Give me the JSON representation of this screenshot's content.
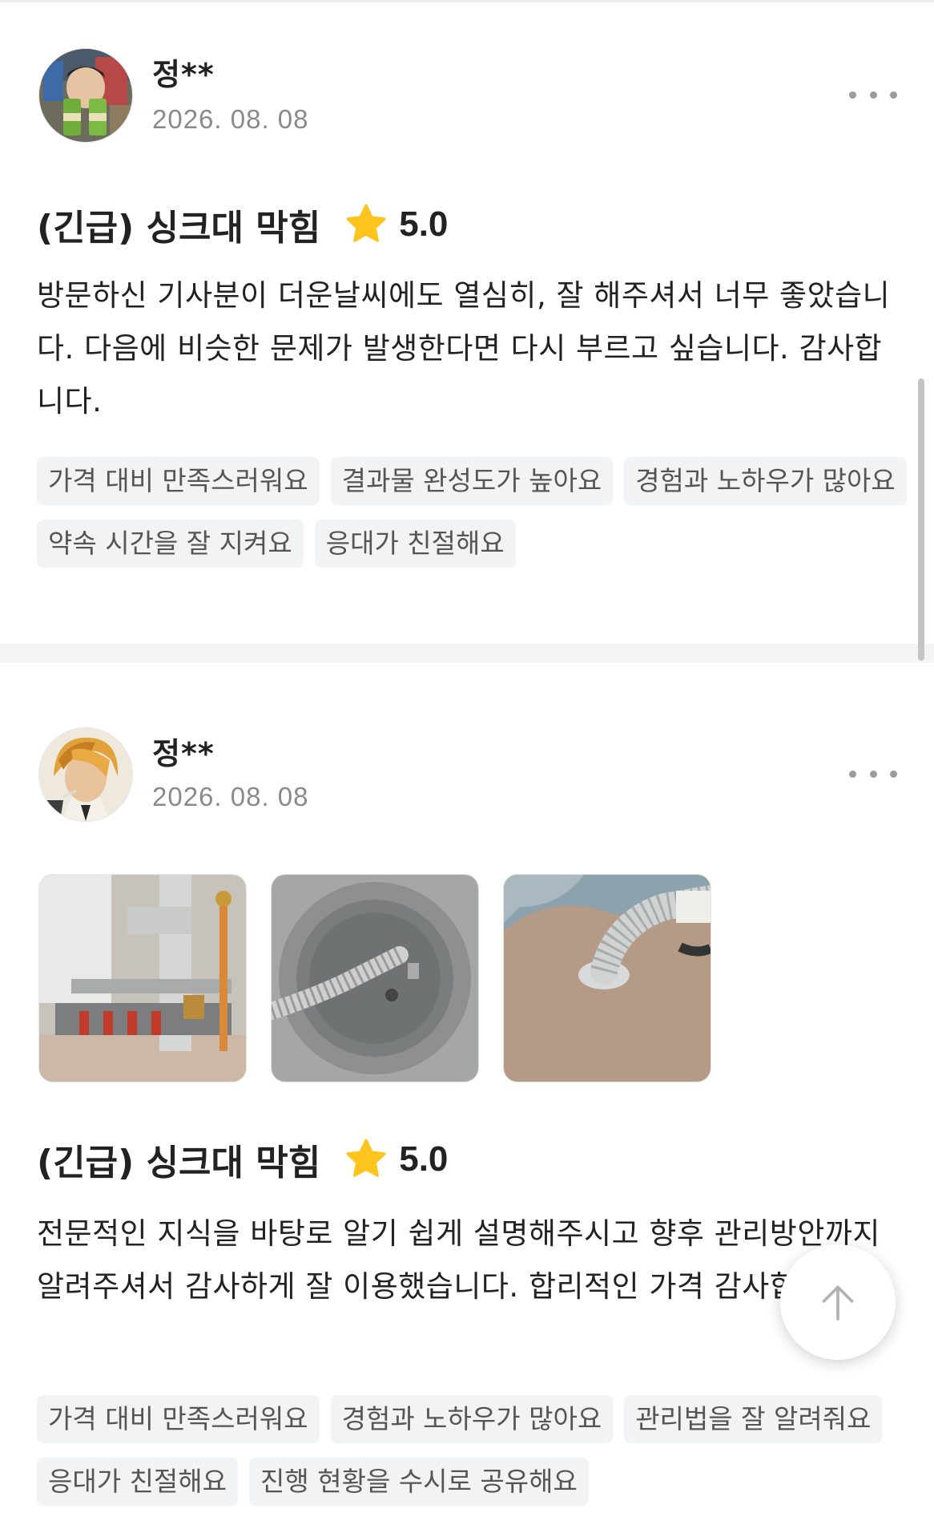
{
  "reviews": [
    {
      "user_name": "정**",
      "date": "2026. 08. 08",
      "title": "(긴급) 싱크대 막힘",
      "rating": "5.0",
      "body": "방문하신 기사분이 더운날씨에도 열심히, 잘 해주셔서 너무 좋았습니다. 다음에 비슷한 문제가 발생한다면 다시 부르고 싶습니다. 감사합니다.",
      "tags": [
        "가격 대비 만족스러워요",
        "결과물 완성도가 높아요",
        "경험과 노하우가 많아요",
        "약속 시간을 잘 지켜요",
        "응대가 친절해요"
      ]
    },
    {
      "user_name": "정**",
      "date": "2026. 08. 08",
      "title": "(긴급) 싱크대 막힘",
      "rating": "5.0",
      "body": "전문적인 지식을 바탕로 알기 쉽게 설명해주시고 향후 관리방안까지 알려주셔서 감사하게 잘 이용했습니다. 합리적인 가격 감사합니다.",
      "tags": [
        "가격 대비 만족스러워요",
        "경험과 노하우가 많아요",
        "관리법을 잘 알려줘요",
        "응대가 친절해요",
        "진행 현황을 수시로 공유해요"
      ]
    }
  ],
  "icons": {
    "star": "star-icon",
    "more": "more-options-icon",
    "scroll_top": "arrow-up-icon"
  },
  "colors": {
    "star": "#FFC51E",
    "tag_bg": "#F2F3F5",
    "divider": "#F4F4F5"
  }
}
